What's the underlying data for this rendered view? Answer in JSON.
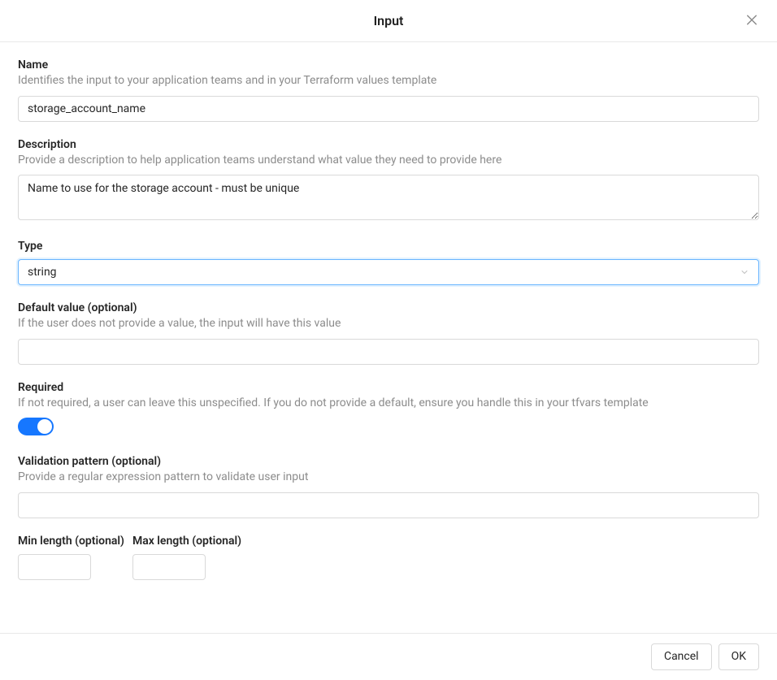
{
  "header": {
    "title": "Input"
  },
  "form": {
    "name": {
      "label": "Name",
      "help": "Identifies the input to your application teams and in your Terraform values template",
      "value": "storage_account_name"
    },
    "description": {
      "label": "Description",
      "help": "Provide a description to help application teams understand what value they need to provide here",
      "value": "Name to use for the storage account - must be unique"
    },
    "type": {
      "label": "Type",
      "value": "string"
    },
    "defaultValue": {
      "label": "Default value (optional)",
      "help": "If the user does not provide a value, the input will have this value",
      "value": ""
    },
    "required": {
      "label": "Required",
      "help": "If not required, a user can leave this unspecified. If you do not provide a default, ensure you handle this in your tfvars template",
      "value": true
    },
    "validationPattern": {
      "label": "Validation pattern (optional)",
      "help": "Provide a regular expression pattern to validate user input",
      "value": ""
    },
    "minLength": {
      "label": "Min length (optional)",
      "value": ""
    },
    "maxLength": {
      "label": "Max length (optional)",
      "value": ""
    }
  },
  "footer": {
    "cancel": "Cancel",
    "ok": "OK"
  }
}
